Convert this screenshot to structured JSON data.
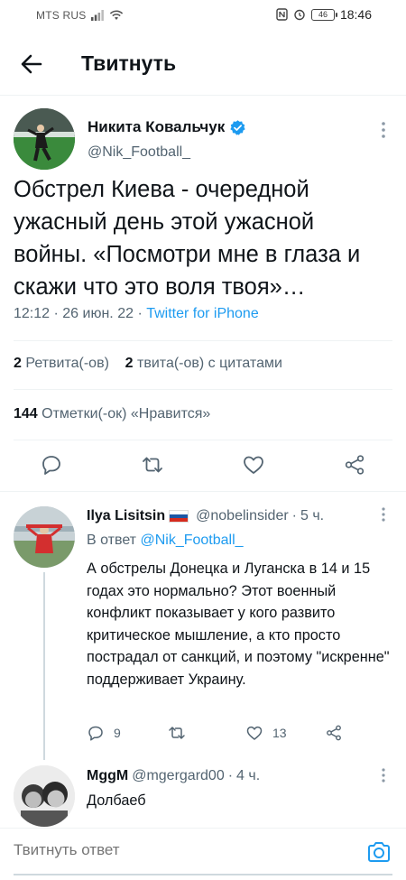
{
  "status_bar": {
    "carrier": "MTS RUS",
    "battery": "46",
    "time": "18:46"
  },
  "header": {
    "title": "Твитнуть"
  },
  "main_tweet": {
    "author_name": "Никита Ковальчук",
    "author_handle": "@Nik_Football_",
    "text": "Обстрел Киева - очередной ужасный день этой ужасной войны. «Посмотри мне в глаза и скажи что это воля твоя»…",
    "time": "12:12",
    "date": "26 июн. 22",
    "source": "Twitter for iPhone",
    "retweets_count": "2",
    "retweets_label": "Ретвита(-ов)",
    "quotes_count": "2",
    "quotes_label": "твита(-ов) с цитатами",
    "likes_count": "144",
    "likes_label": "Отметки(-ок) «Нравится»",
    "verified_color": "#1d9bf0"
  },
  "replies": [
    {
      "name": "Ilya Lisitsin",
      "handle": "@nobelinsider",
      "age": "5 ч.",
      "reply_prefix": "В ответ",
      "reply_to": "@Nik_Football_",
      "text": "А обстрелы Донецка и Луганска в 14 и 15 годах это нормально? Этот военный конфликт показывает у кого развито критическое мышление, а кто просто пострадал от санкций,  и поэтому \"искренне\" поддерживает Украину.",
      "replies_count": "9",
      "retweets_count": "",
      "likes_count": "13"
    },
    {
      "name": "MggM",
      "handle": "@mgergard00",
      "age": "4 ч.",
      "text": "Долбаеб"
    }
  ],
  "compose": {
    "placeholder": "Твитнуть ответ"
  },
  "colors": {
    "accent": "#1d9bf0",
    "secondary_text": "#536471",
    "primary_text": "#0f1419"
  }
}
